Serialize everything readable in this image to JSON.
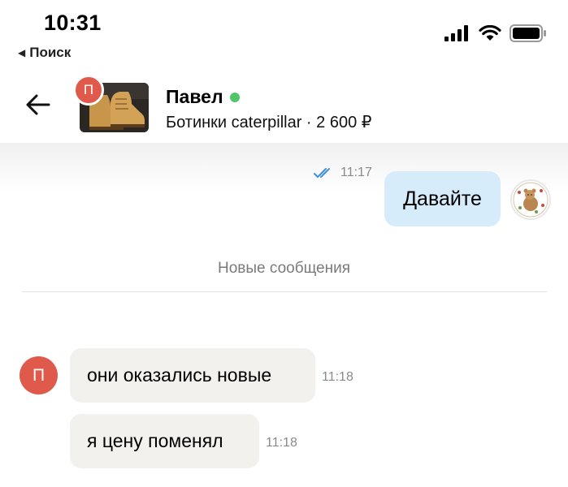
{
  "status_bar": {
    "time": "10:31",
    "back_label": "Поиск",
    "icons": [
      "signal-icon",
      "wifi-icon",
      "battery-icon"
    ]
  },
  "header": {
    "seller_name": "Павел",
    "seller_initial": "П",
    "online": true,
    "product_title": "Ботинки caterpillar · 2 600 ₽"
  },
  "messages": {
    "outgoing": {
      "text": "Давайте",
      "time": "11:17",
      "read": true
    },
    "divider": "Новые сообщения",
    "incoming_avatar_initial": "П",
    "incoming": [
      {
        "text": "они оказались новые",
        "time": "11:18"
      },
      {
        "text": "я цену поменял",
        "time": "11:18"
      }
    ]
  },
  "colors": {
    "outgoing_bubble": "#d7ecfb",
    "incoming_bubble": "#f3f1ee",
    "avatar_red": "#e05a4b",
    "online_green": "#54c46a",
    "read_check": "#3f8fe0"
  }
}
